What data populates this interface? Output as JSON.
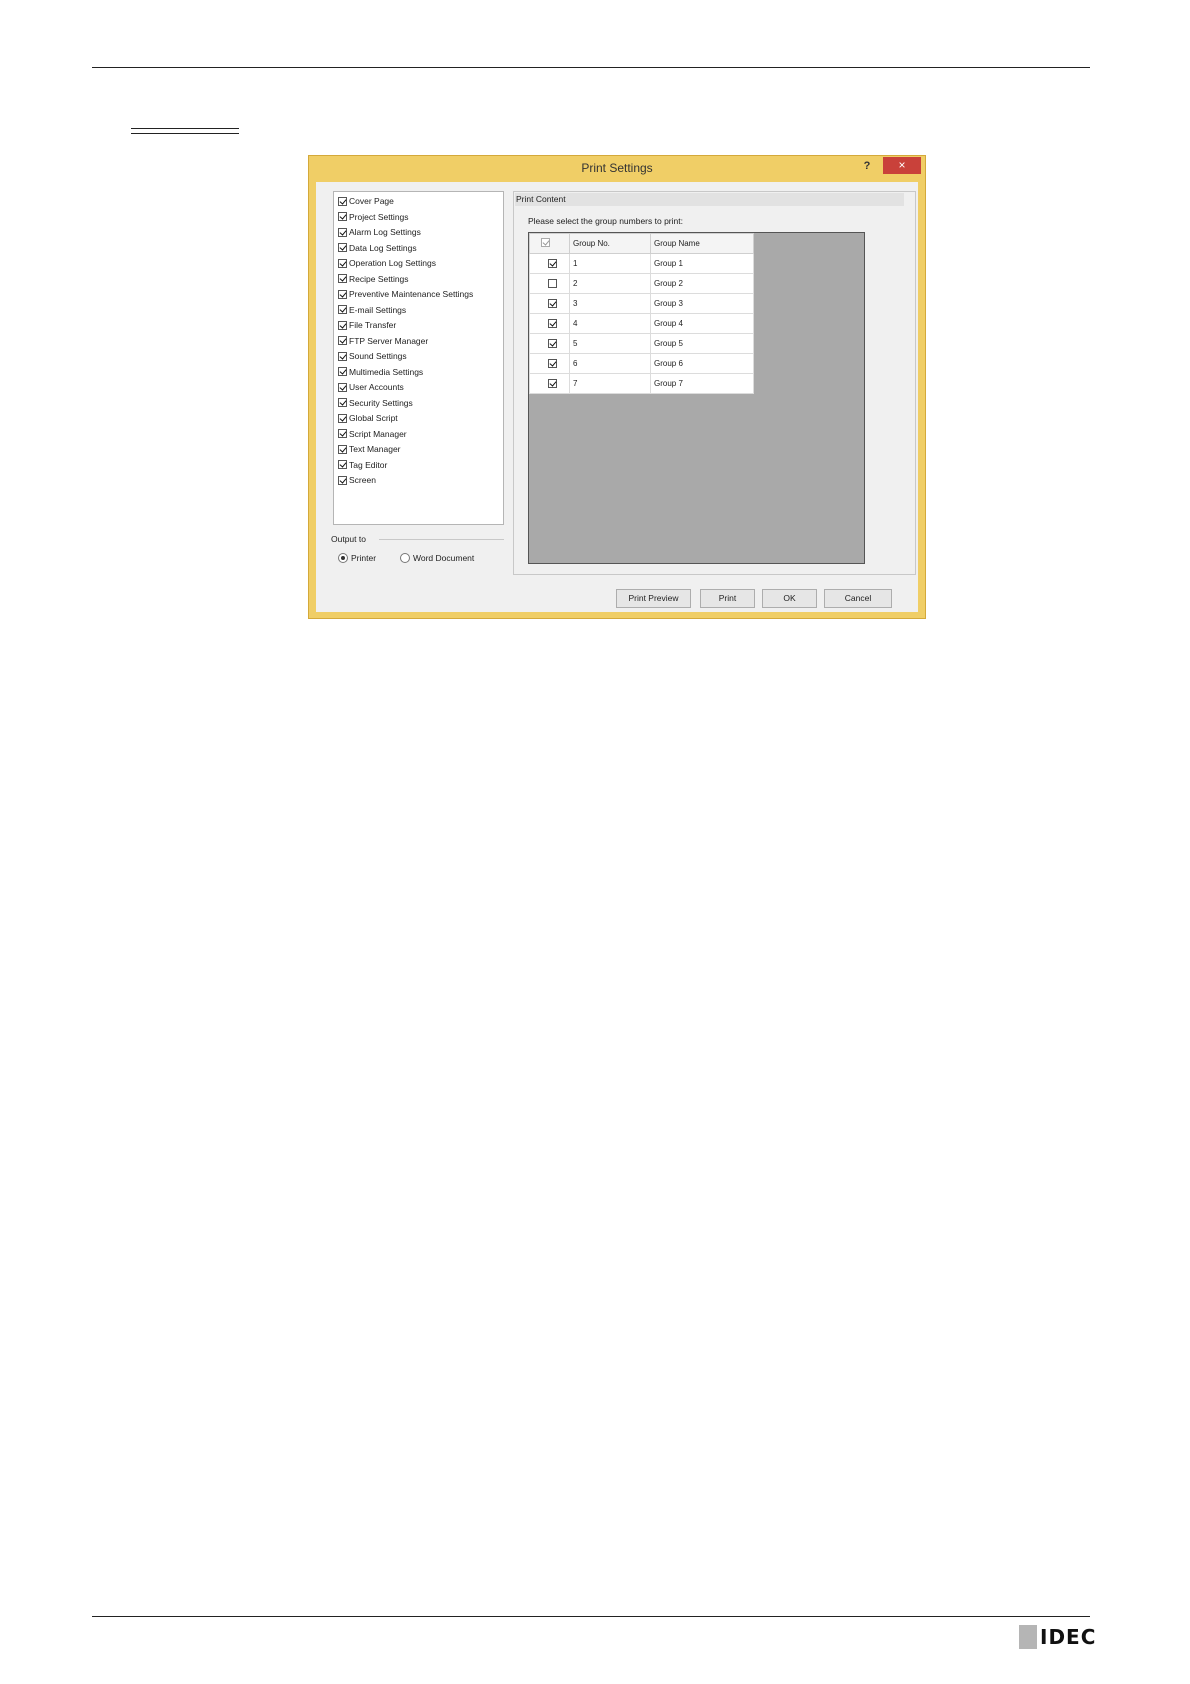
{
  "dialog": {
    "title": "Print Settings",
    "help_label": "?",
    "close_label": "×"
  },
  "categories": [
    {
      "label": "Cover Page",
      "checked": true
    },
    {
      "label": "Project Settings",
      "checked": true
    },
    {
      "label": "Alarm Log Settings",
      "checked": true
    },
    {
      "label": "Data Log Settings",
      "checked": true
    },
    {
      "label": "Operation Log Settings",
      "checked": true
    },
    {
      "label": "Recipe Settings",
      "checked": true
    },
    {
      "label": "Preventive Maintenance Settings",
      "checked": true
    },
    {
      "label": "E-mail Settings",
      "checked": true
    },
    {
      "label": "File Transfer",
      "checked": true
    },
    {
      "label": "FTP Server Manager",
      "checked": true
    },
    {
      "label": "Sound Settings",
      "checked": true
    },
    {
      "label": "Multimedia Settings",
      "checked": true
    },
    {
      "label": "User Accounts",
      "checked": true
    },
    {
      "label": "Security Settings",
      "checked": true
    },
    {
      "label": "Global Script",
      "checked": true
    },
    {
      "label": "Script Manager",
      "checked": true
    },
    {
      "label": "Text Manager",
      "checked": true
    },
    {
      "label": "Tag Editor",
      "checked": true
    },
    {
      "label": "Screen",
      "checked": true
    }
  ],
  "output": {
    "label": "Output to",
    "printer_label": "Printer",
    "word_label": "Word Document",
    "selected": "printer"
  },
  "content": {
    "header": "Print Content",
    "instruction": "Please select the group numbers to print:",
    "columns": [
      "Group No.",
      "Group Name"
    ],
    "header_checked": true,
    "rows": [
      {
        "checked": true,
        "no": "1",
        "name": "Group 1"
      },
      {
        "checked": false,
        "no": "2",
        "name": "Group 2"
      },
      {
        "checked": true,
        "no": "3",
        "name": "Group 3"
      },
      {
        "checked": true,
        "no": "4",
        "name": "Group 4"
      },
      {
        "checked": true,
        "no": "5",
        "name": "Group 5"
      },
      {
        "checked": true,
        "no": "6",
        "name": "Group 6"
      },
      {
        "checked": true,
        "no": "7",
        "name": "Group 7"
      }
    ]
  },
  "buttons": {
    "print_preview": "Print Preview",
    "print": "Print",
    "ok": "OK",
    "cancel": "Cancel"
  },
  "footer": {
    "logo_text": "IDEC"
  }
}
